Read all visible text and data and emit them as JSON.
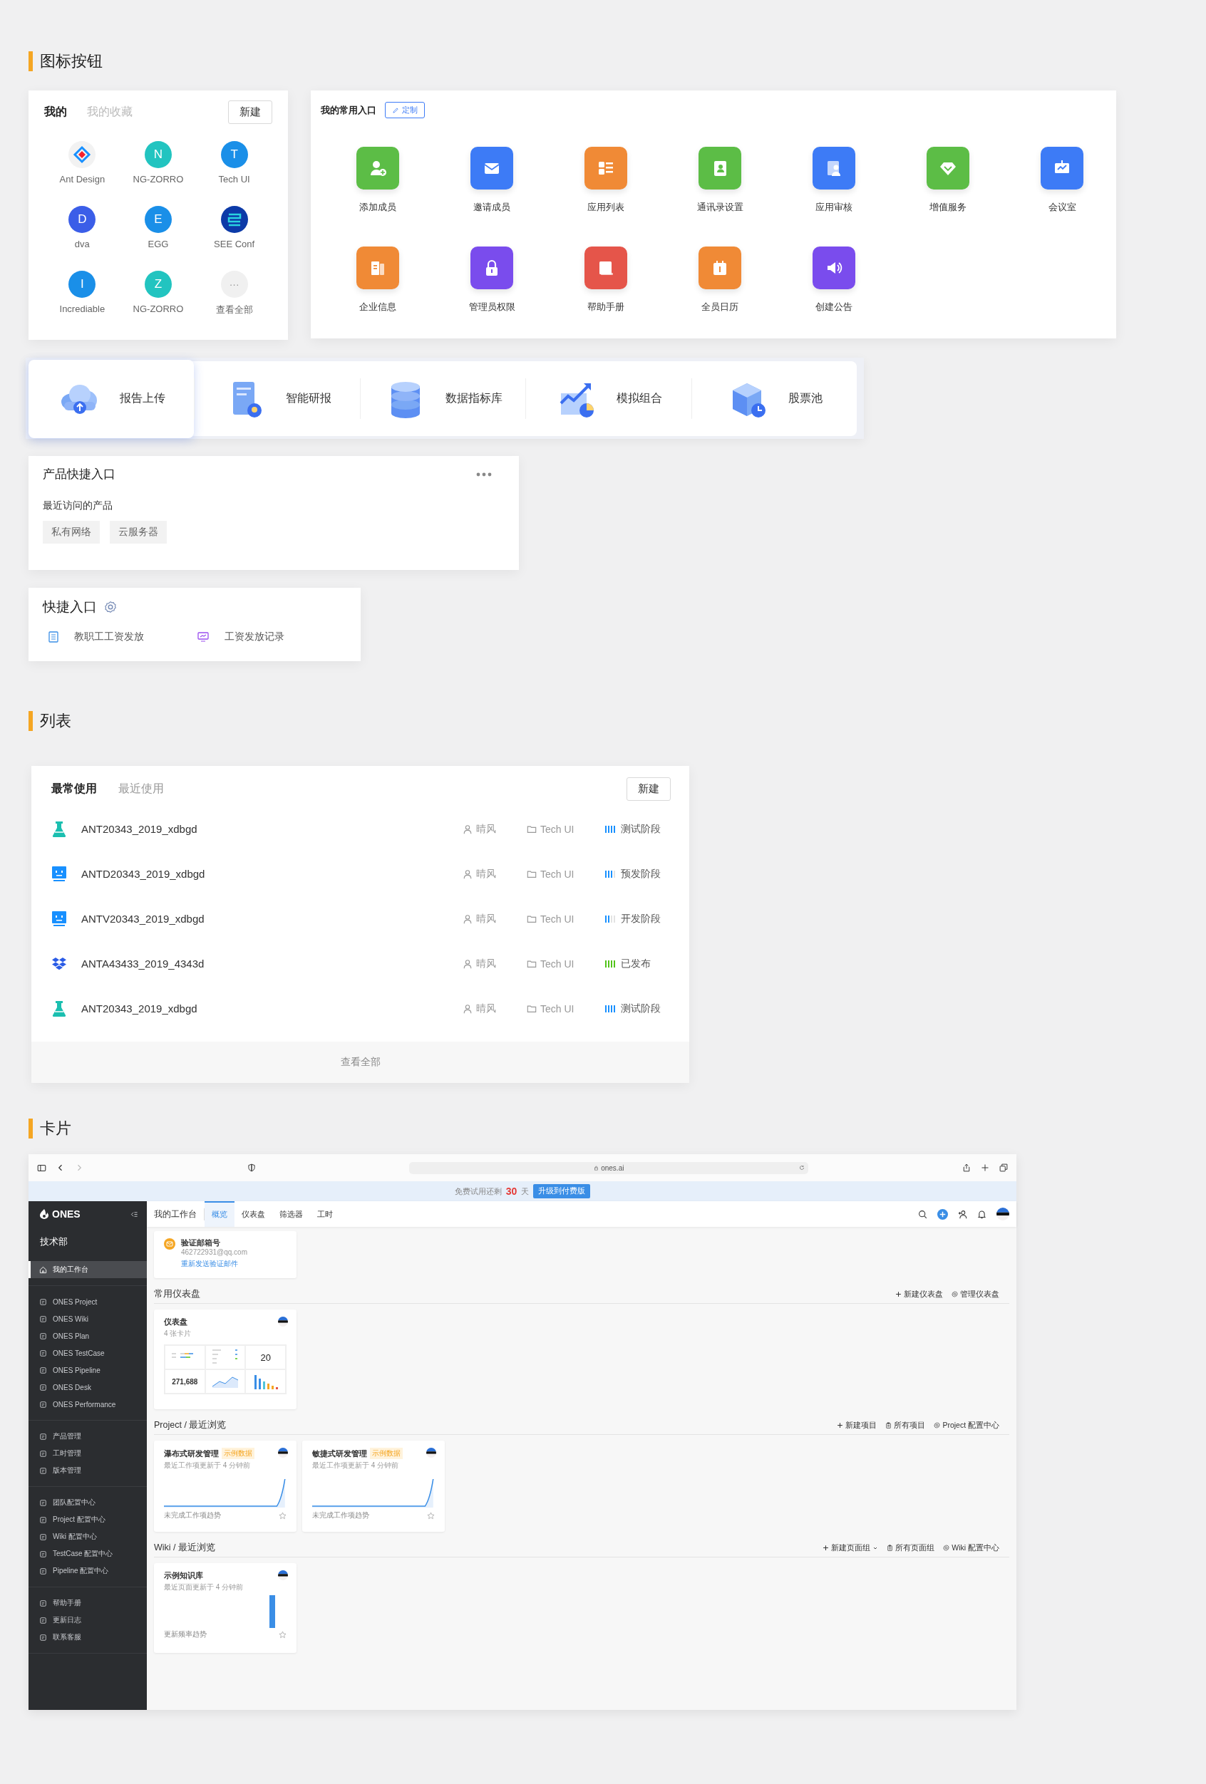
{
  "icon_buttons": {
    "heading": "图标按钮",
    "apps_panel": {
      "tabs": [
        {
          "label": "我的",
          "selected": true
        },
        {
          "label": "我的收藏",
          "selected": false
        }
      ],
      "new_button": "新建",
      "apps": [
        {
          "kind": "logo",
          "label": "Ant Design"
        },
        {
          "kind": "letter",
          "letter": "N",
          "label": "NG-ZORRO",
          "color": "#22c4c0"
        },
        {
          "kind": "letter",
          "letter": "T",
          "label": "Tech UI",
          "color": "#1a8fe8"
        },
        {
          "kind": "letter",
          "letter": "D",
          "label": "dva",
          "color": "#3b5ee8"
        },
        {
          "kind": "letter",
          "letter": "E",
          "label": "EGG",
          "color": "#1a8fe8"
        },
        {
          "kind": "logo",
          "label": "SEE Conf"
        },
        {
          "kind": "letter",
          "letter": "I",
          "label": "Incrediable",
          "color": "#1a8fe8"
        },
        {
          "kind": "letter",
          "letter": "Z",
          "label": "NG-ZORRO",
          "color": "#22c4c0"
        },
        {
          "kind": "more",
          "symbol": "···",
          "label": "查看全部"
        }
      ]
    },
    "shortcuts_panel": {
      "title": "我的常用入口",
      "customize_button": "定制",
      "items": [
        {
          "label": "添加成员",
          "color": "#5cbd46"
        },
        {
          "label": "邀请成员",
          "color": "#3d7bf6"
        },
        {
          "label": "应用列表",
          "color": "#f08a36"
        },
        {
          "label": "通讯录设置",
          "color": "#5cbd46"
        },
        {
          "label": "应用审核",
          "color": "#3d7bf6"
        },
        {
          "label": "增值服务",
          "color": "#5cbd46"
        },
        {
          "label": "会议室",
          "color": "#3d7bf6"
        },
        {
          "label": "企业信息",
          "color": "#f08a36"
        },
        {
          "label": "管理员权限",
          "color": "#7a4ced"
        },
        {
          "label": "帮助手册",
          "color": "#e5554a"
        },
        {
          "label": "全员日历",
          "color": "#f08a36"
        },
        {
          "label": "创建公告",
          "color": "#7a4ced"
        }
      ]
    },
    "feature_bar": {
      "items": [
        {
          "label": "报告上传",
          "selected": true
        },
        {
          "label": "智能研报",
          "selected": false
        },
        {
          "label": "数据指标库",
          "selected": false
        },
        {
          "label": "模拟组合",
          "selected": false
        },
        {
          "label": "股票池",
          "selected": false
        }
      ]
    },
    "product_card": {
      "title": "产品快捷入口",
      "subtitle": "最近访问的产品",
      "tags": [
        "私有网络",
        "云服务器"
      ]
    },
    "quick_entry": {
      "title": "快捷入口",
      "links": [
        "教职工工资发放",
        "工资发放记录"
      ]
    }
  },
  "list": {
    "heading": "列表",
    "tabs": [
      {
        "label": "最常使用",
        "selected": true
      },
      {
        "label": "最近使用",
        "selected": false
      }
    ],
    "new_button": "新建",
    "rows": [
      {
        "name": "ANT20343_2019_xdbgd",
        "owner": "晴风",
        "project": "Tech UI",
        "stage": "测试阶段",
        "level": 1,
        "color": "#1890ff"
      },
      {
        "name": "ANTD20343_2019_xdbgd",
        "owner": "晴风",
        "project": "Tech UI",
        "stage": "预发阶段",
        "level": 0.75,
        "color": "#1890ff"
      },
      {
        "name": "ANTV20343_2019_xdbgd",
        "owner": "晴风",
        "project": "Tech UI",
        "stage": "开发阶段",
        "level": 0.5,
        "color": "#1890ff"
      },
      {
        "name": "ANTA43433_2019_4343d",
        "owner": "晴风",
        "project": "Tech UI",
        "stage": "已发布",
        "level": 1,
        "color": "#52c41a"
      },
      {
        "name": "ANT20343_2019_xdbgd",
        "owner": "晴风",
        "project": "Tech UI",
        "stage": "测试阶段",
        "level": 1,
        "color": "#1890ff"
      }
    ],
    "footer": "查看全部"
  },
  "cards": {
    "heading": "卡片",
    "browser": {
      "url": "ones.ai",
      "banner": {
        "text": "免费试用还剩",
        "days": "30",
        "unit": "天",
        "button": "升级到付费版"
      },
      "sidebar": {
        "logo": "ONES",
        "team": "技术部",
        "groups": [
          {
            "items": [
              {
                "label": "我的工作台",
                "selected": true
              }
            ]
          },
          {
            "items": [
              {
                "label": "ONES Project",
                "selected": false
              },
              {
                "label": "ONES Wiki",
                "selected": false
              },
              {
                "label": "ONES Plan",
                "selected": false
              },
              {
                "label": "ONES TestCase",
                "selected": false
              },
              {
                "label": "ONES Pipeline",
                "selected": false
              },
              {
                "label": "ONES Desk",
                "selected": false
              },
              {
                "label": "ONES Performance",
                "selected": false
              }
            ]
          },
          {
            "items": [
              {
                "label": "产品管理",
                "selected": false
              },
              {
                "label": "工时管理",
                "selected": false
              },
              {
                "label": "版本管理",
                "selected": false
              }
            ]
          },
          {
            "items": [
              {
                "label": "团队配置中心",
                "selected": false
              },
              {
                "label": "Project 配置中心",
                "selected": false
              },
              {
                "label": "Wiki 配置中心",
                "selected": false
              },
              {
                "label": "TestCase 配置中心",
                "selected": false
              },
              {
                "label": "Pipeline 配置中心",
                "selected": false
              }
            ]
          },
          {
            "items": [
              {
                "label": "帮助手册",
                "selected": false
              },
              {
                "label": "更新日志",
                "selected": false
              },
              {
                "label": "联系客服",
                "selected": false
              }
            ]
          }
        ]
      },
      "header": {
        "title": "我的工作台",
        "tabs": [
          {
            "label": "概览",
            "selected": true
          },
          {
            "label": "仪表盘",
            "selected": false
          },
          {
            "label": "筛选器",
            "selected": false
          },
          {
            "label": "工时",
            "selected": false
          }
        ]
      },
      "email_card": {
        "title": "验证邮箱号",
        "email": "462722931@qq.com",
        "link": "重新发送验证邮件"
      },
      "dashboards": {
        "title": "常用仪表盘",
        "actions": [
          {
            "kind": "create",
            "label": "新建仪表盘",
            "menu": false
          },
          {
            "kind": "settings",
            "label": "管理仪表盘",
            "menu": false
          }
        ],
        "card": {
          "title": "仪表盘",
          "subtitle": "4 张卡片",
          "metric": "20",
          "total": "271,688"
        }
      },
      "projects": {
        "title": "Project / 最近浏览",
        "actions": [
          {
            "kind": "create",
            "label": "新建项目",
            "menu": false
          },
          {
            "kind": "browse",
            "label": "所有项目",
            "menu": false
          },
          {
            "kind": "settings",
            "label": "Project 配置中心",
            "menu": false
          }
        ],
        "cards": [
          {
            "title": "瀑布式研发管理",
            "tag": "示例数据",
            "subtitle": "最近工作项更新于 4 分钟前",
            "footer": "未完成工作项趋势"
          },
          {
            "title": "敏捷式研发管理",
            "tag": "示例数据",
            "subtitle": "最近工作项更新于 4 分钟前",
            "footer": "未完成工作项趋势"
          }
        ]
      },
      "wiki": {
        "title": "Wiki / 最近浏览",
        "actions": [
          {
            "kind": "create",
            "label": "新建页面组",
            "menu": true
          },
          {
            "kind": "browse",
            "label": "所有页面组",
            "menu": false
          },
          {
            "kind": "settings",
            "label": "Wiki 配置中心",
            "menu": false
          }
        ],
        "cards": [
          {
            "title": "示例知识库",
            "subtitle": "最近页面更新于 4 分钟前",
            "footer": "更新频率趋势"
          }
        ]
      }
    }
  }
}
